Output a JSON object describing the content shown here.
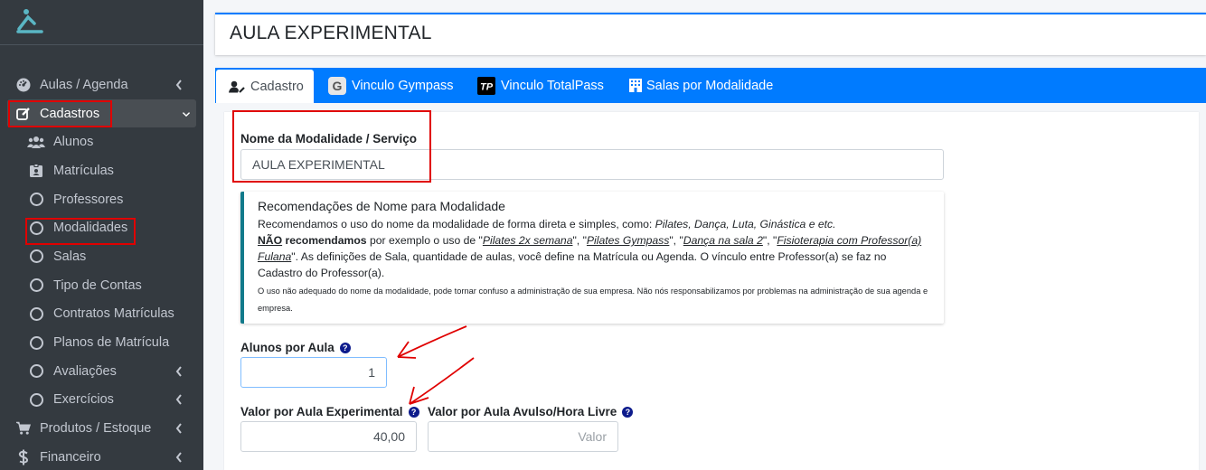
{
  "sidebar": {
    "items": [
      {
        "label": "Aulas / Agenda",
        "icon": "tachometer-icon"
      },
      {
        "label": "Cadastros",
        "icon": "edit-icon"
      },
      {
        "label": "Alunos",
        "icon": "users-icon"
      },
      {
        "label": "Matrículas",
        "icon": "id-badge-icon"
      },
      {
        "label": "Professores",
        "icon": "circle-icon"
      },
      {
        "label": "Modalidades",
        "icon": "circle-icon"
      },
      {
        "label": "Salas",
        "icon": "circle-icon"
      },
      {
        "label": "Tipo de Contas",
        "icon": "circle-icon"
      },
      {
        "label": "Contratos Matrículas",
        "icon": "circle-icon"
      },
      {
        "label": "Planos de Matrícula",
        "icon": "circle-icon"
      },
      {
        "label": "Avaliações",
        "icon": "circle-icon"
      },
      {
        "label": "Exercícios",
        "icon": "circle-icon"
      },
      {
        "label": "Produtos / Estoque",
        "icon": "cart-icon"
      },
      {
        "label": "Financeiro",
        "icon": "dollar-icon"
      }
    ]
  },
  "header": {
    "title": "AULA EXPERIMENTAL"
  },
  "tabs": [
    {
      "label": "Cadastro",
      "icon": "user-edit-icon"
    },
    {
      "label": "Vinculo Gympass",
      "icon": "gympass-icon"
    },
    {
      "label": "Vinculo TotalPass",
      "icon": "totalpass-icon"
    },
    {
      "label": "Salas por Modalidade",
      "icon": "building-icon"
    }
  ],
  "form": {
    "nome_label": "Nome da Modalidade / Serviço",
    "nome_value": "AULA EXPERIMENTAL",
    "callout": {
      "title": "Recomendações de Nome para Modalidade",
      "line1_a": "Recomendamos o uso do nome da modalidade de forma direta e simples, como: ",
      "line1_b": "Pilates, Dança, Luta, Ginástica e etc.",
      "nao": "NÃO",
      "recomendamos": " recomendamos",
      "line2_a": " por exemplo o uso de \"",
      "ex1": "Pilates 2x semana",
      "sep1": "\", \"",
      "ex2": "Pilates Gympass",
      "sep2": "\", \"",
      "ex3": "Dança na sala 2",
      "sep3": "\", \"",
      "ex4": "Fisioterapia com Professor(a) Fulana",
      "line2_b": "\". As definições de Sala, quantidade de aulas, você define na Matrícula ou Agenda. O vínculo entre Professor(a) se faz no Cadastro do Professor(a).",
      "small": "O uso não adequado do nome da modalidade, pode tornar confuso a administração de sua empresa. Não nós responsabilizamos por problemas na administração de sua agenda e empresa."
    },
    "alunos_label": "Alunos por Aula",
    "alunos_value": "1",
    "valor_exp_label": "Valor por Aula Experimental",
    "valor_exp_value": "40,00",
    "valor_avulso_label": "Valor por Aula Avulso/Hora Livre",
    "valor_avulso_placeholder": "Valor",
    "help_glyph": "?"
  },
  "colors": {
    "sidebar": "#343a40",
    "accent": "#007bff",
    "annotation": "#e00000",
    "callout_border": "#117a8b"
  }
}
